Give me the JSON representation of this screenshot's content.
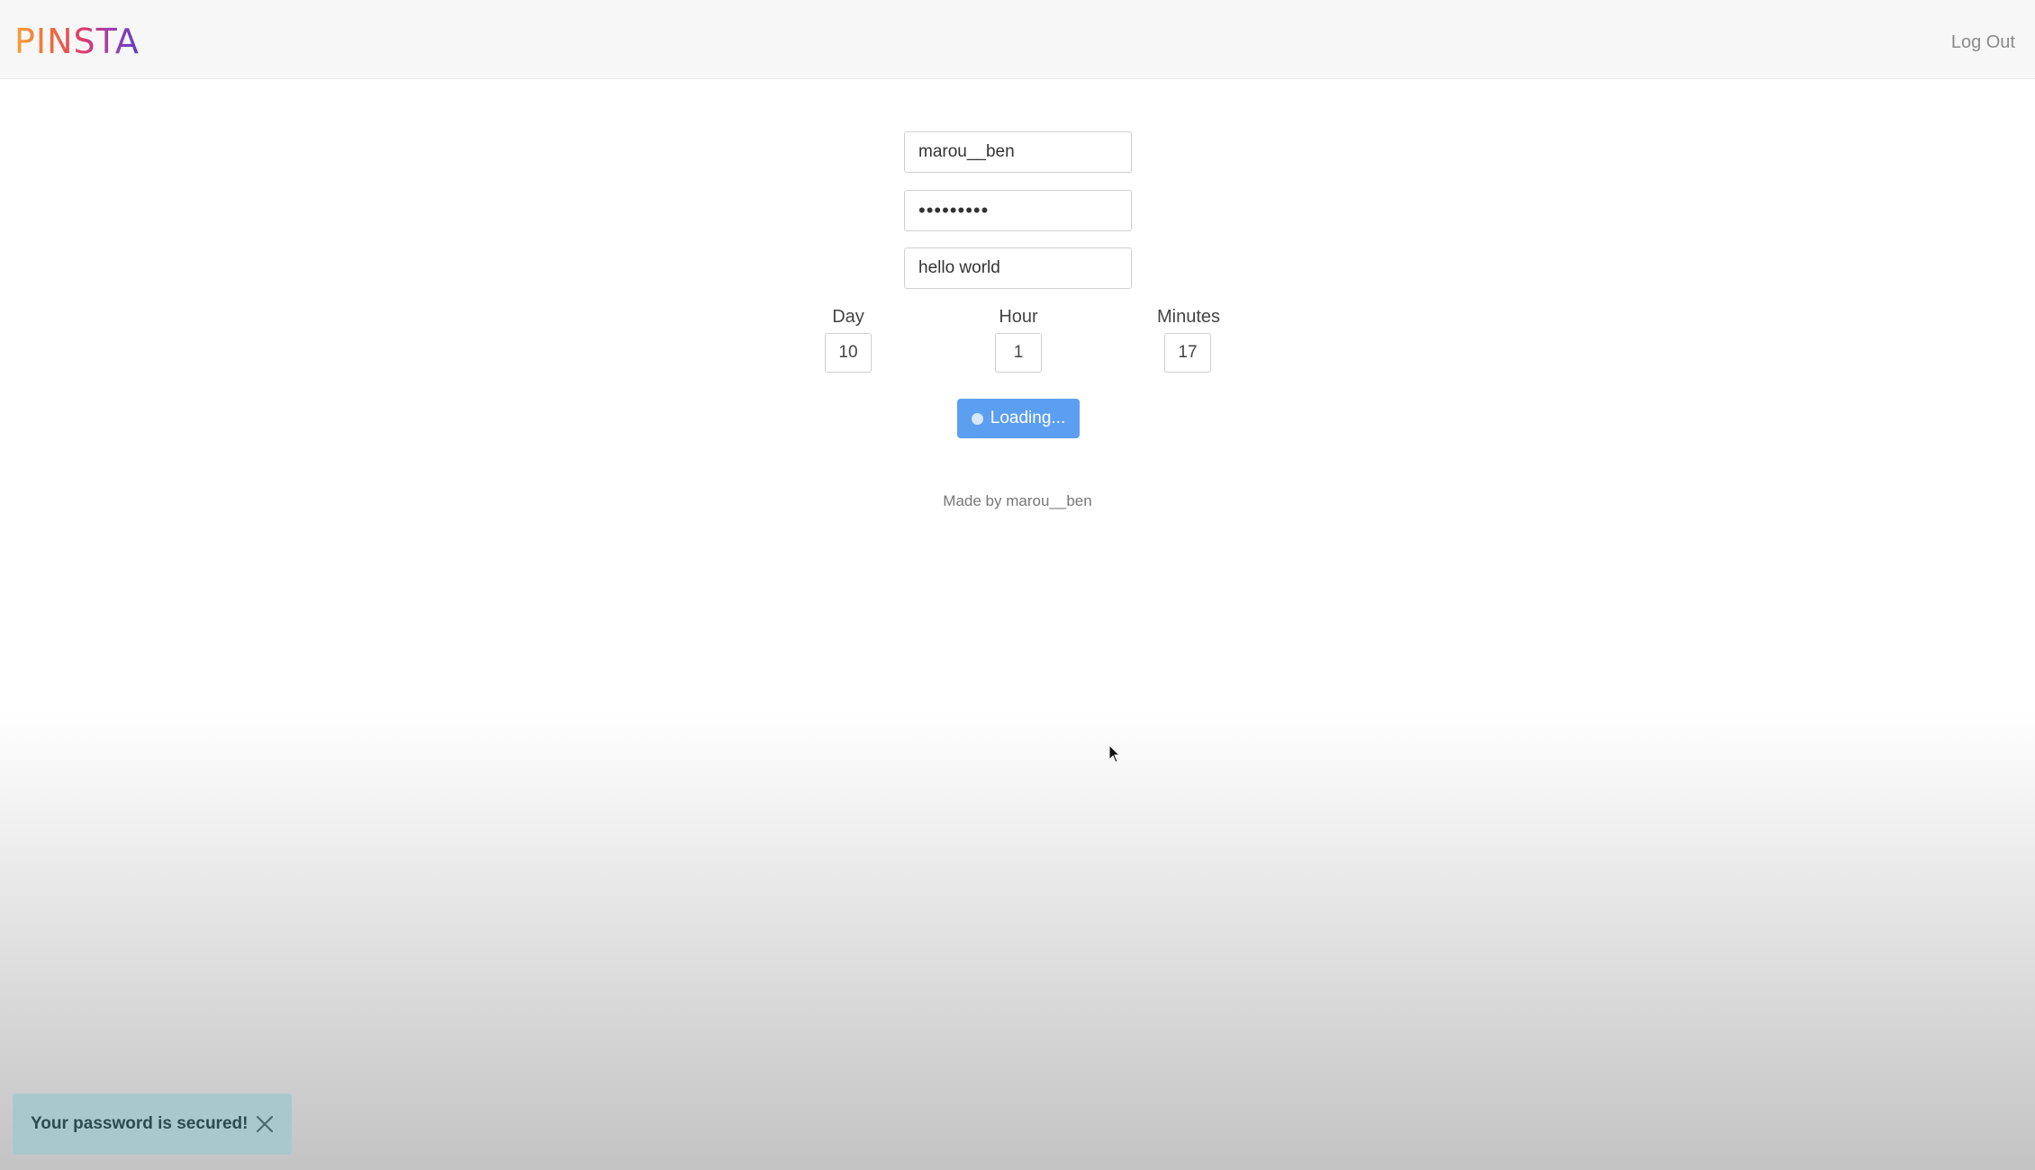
{
  "header": {
    "brand": "PINSTA",
    "logout_label": "Log Out"
  },
  "form": {
    "username": "marou__ben",
    "password": "•••••••••",
    "message": "hello world",
    "day_label": "Day",
    "day_value": "10",
    "hour_label": "Hour",
    "hour_value": "1",
    "minutes_label": "Minutes",
    "minutes_value": "17",
    "submit_label": "Loading..."
  },
  "footer": {
    "credit": "Made by marou__ben"
  },
  "toast": {
    "message": "Your password is secured!"
  },
  "colors": {
    "button": "#5c9ff0",
    "toast_bg": "#a9c8cc",
    "toast_text": "#2c4a50"
  },
  "icons": {
    "toast_close": "close-icon",
    "spinner": "spinner-icon",
    "cursor": "mouse-pointer-icon"
  }
}
